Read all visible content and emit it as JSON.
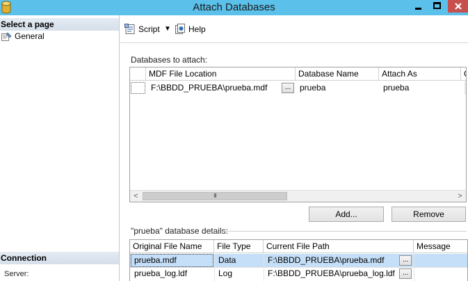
{
  "window": {
    "title": "Attach Databases",
    "titlebar_color": "#5bc0ea",
    "close_color": "#c7504f",
    "icons": [
      "database-icon",
      "minimize-icon",
      "maximize-icon",
      "close-icon"
    ]
  },
  "left_panel": {
    "select_page_heading": "Select a page",
    "pages": [
      {
        "label": "General",
        "icon": "wrench-page-icon"
      }
    ],
    "connection_heading": "Connection",
    "server_label": "Server:"
  },
  "toolbar": {
    "script_label": "Script",
    "script_icon": "script-icon",
    "dropdown_caret": "▼",
    "help_label": "Help",
    "help_icon": "help-icon"
  },
  "attach": {
    "label": "Databases to attach:",
    "columns": [
      "MDF File Location",
      "Database Name",
      "Attach As",
      "O"
    ],
    "rows": [
      {
        "mdf_location": "F:\\BBDD_PRUEBA\\prueba.mdf",
        "browse": "...",
        "database_name": "prueba",
        "attach_as": "prueba"
      }
    ],
    "scroll_left": "<",
    "scroll_right": ">",
    "scroll_thumb": "III",
    "add_button": "Add...",
    "remove_button": "Remove"
  },
  "details": {
    "label": "\"prueba\" database details:",
    "columns": [
      "Original File Name",
      "File Type",
      "Current File Path",
      "Message"
    ],
    "rows": [
      {
        "original": "prueba.mdf",
        "type": "Data",
        "path": "F:\\BBDD_PRUEBA\\prueba.mdf",
        "browse": "...",
        "message": ""
      },
      {
        "original": "prueba_log.ldf",
        "type": "Log",
        "path": "F:\\BBDD_PRUEBA\\prueba_log.ldf",
        "browse": "...",
        "message": ""
      }
    ],
    "selection_color": "#c5dff8"
  }
}
